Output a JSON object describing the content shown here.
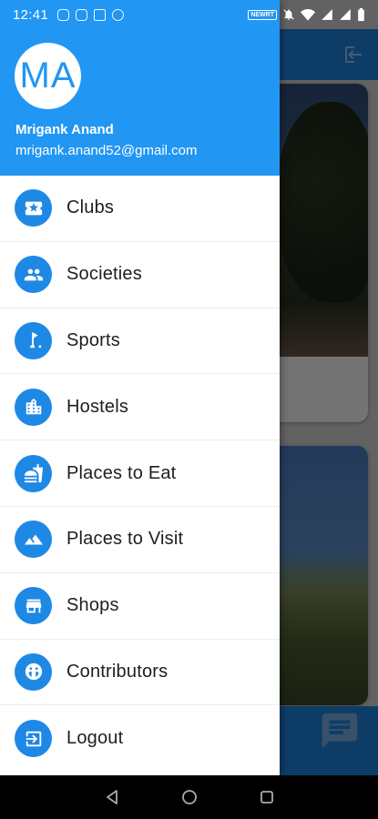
{
  "status_bar": {
    "time": "12:41",
    "network_label": "NEWRT"
  },
  "drawer": {
    "avatar_initials": "MA",
    "user_name": "Mrigank Anand",
    "user_email": "mrigank.anand52@gmail.com",
    "items": [
      {
        "label": "Clubs",
        "icon": "ticket-star-icon"
      },
      {
        "label": "Societies",
        "icon": "people-icon"
      },
      {
        "label": "Sports",
        "icon": "golf-icon"
      },
      {
        "label": "Hostels",
        "icon": "building-icon"
      },
      {
        "label": "Places to Eat",
        "icon": "fastfood-icon"
      },
      {
        "label": "Places to Visit",
        "icon": "landscape-icon"
      },
      {
        "label": "Shops",
        "icon": "store-icon"
      },
      {
        "label": "Contributors",
        "icon": "community-icon"
      },
      {
        "label": "Logout",
        "icon": "logout-icon"
      }
    ]
  },
  "colors": {
    "primary": "#2196f3",
    "icon_bg": "#1e88e5"
  }
}
